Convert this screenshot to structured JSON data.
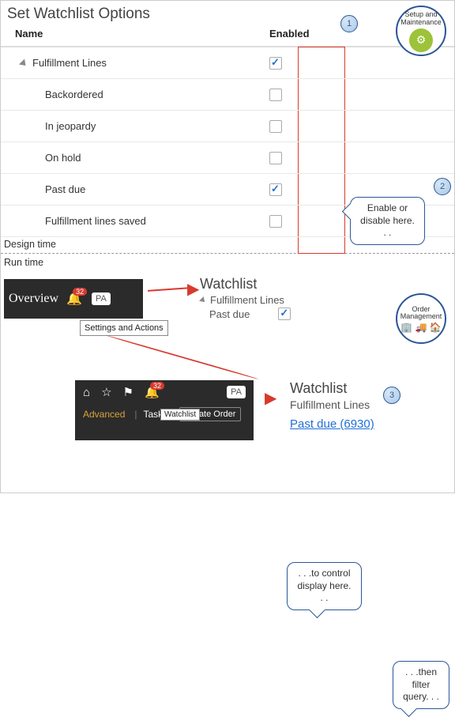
{
  "title": "Set Watchlist Options",
  "columns": {
    "name": "Name",
    "enabled": "Enabled"
  },
  "rows": [
    {
      "label": "Fulfillment Lines",
      "checked": true,
      "parent": true
    },
    {
      "label": "Backordered",
      "checked": false
    },
    {
      "label": "In jeopardy",
      "checked": false
    },
    {
      "label": "On hold",
      "checked": false
    },
    {
      "label": "Past due",
      "checked": true
    },
    {
      "label": "Fulfillment lines saved",
      "checked": false
    }
  ],
  "steps": {
    "s1": "1",
    "s2": "2",
    "s3": "3"
  },
  "callouts": {
    "c1": "Enable or disable here. . .",
    "c2": ". . .to control display here. . .",
    "c3": ". . .then filter query. . ."
  },
  "apps": {
    "setup": "Setup and Maintenance",
    "om": "Order Management"
  },
  "divider": {
    "design": "Design time",
    "runtime": "Run time"
  },
  "runtime1": {
    "overview": "Overview",
    "bell_count": "32",
    "avatar": "PA",
    "settings_tip": "Settings and Actions",
    "watchlist": "Watchlist",
    "group": "Fulfillment Lines",
    "item": "Past due"
  },
  "runtime2": {
    "bell_count": "32",
    "avatar": "PA",
    "advanced": "Advanced",
    "tasks": "Tasks",
    "watch_tip": "Watchlist",
    "create": "Create Order",
    "watchlist": "Watchlist",
    "group": "Fulfillment Lines",
    "link": "Past due (6930)"
  }
}
